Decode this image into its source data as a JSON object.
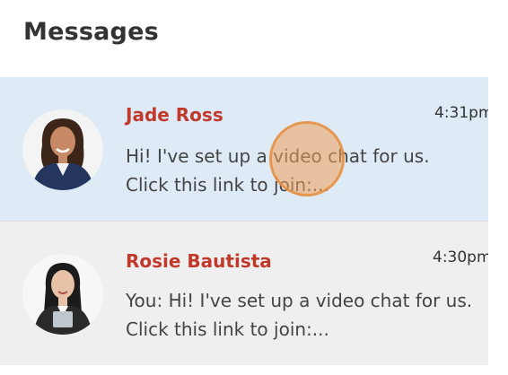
{
  "header": {
    "title": "Messages"
  },
  "conversations": [
    {
      "name": "Jade Ross",
      "time": "4:31pm",
      "preview": "Hi! I've set up a video chat for us. Click this link to join:...",
      "active": true
    },
    {
      "name": "Rosie Bautista",
      "time": "4:30pm",
      "preview": "You: Hi! I've set up a video chat for us. Click this link to join:...",
      "active": false
    }
  ],
  "colors": {
    "name": "#c0392b",
    "active_row": "#deebf7",
    "inactive_row": "#efefef",
    "cursor": "#f0a05a"
  }
}
